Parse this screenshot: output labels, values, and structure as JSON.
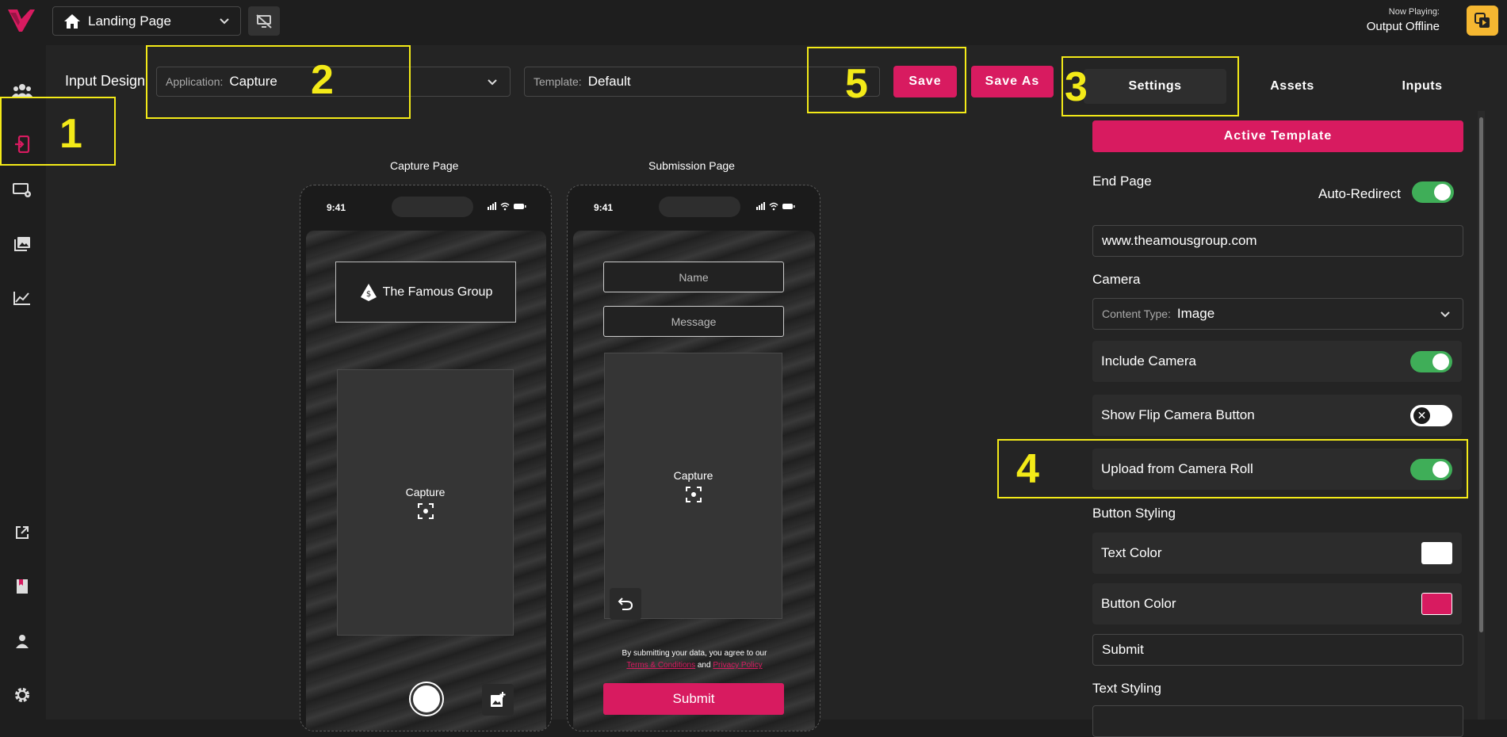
{
  "topbar": {
    "page_selector": "Landing Page",
    "now_playing_label": "Now Playing:",
    "now_playing_value": "Output Offline"
  },
  "toolbar": {
    "title": "Input Design",
    "application_label": "Application:",
    "application_value": "Capture",
    "template_label": "Template:",
    "template_value": "Default",
    "save_label": "Save",
    "save_as_label": "Save As"
  },
  "tabs": [
    {
      "label": "Settings",
      "active": true
    },
    {
      "label": "Assets",
      "active": false
    },
    {
      "label": "Inputs",
      "active": false
    }
  ],
  "annotations": [
    "1",
    "2",
    "3",
    "4",
    "5"
  ],
  "preview": {
    "capture_page": {
      "title": "Capture Page",
      "time": "9:41",
      "logo_text": "The Famous Group",
      "capture_label": "Capture"
    },
    "submission_page": {
      "title": "Submission Page",
      "time": "9:41",
      "name_placeholder": "Name",
      "message_placeholder": "Message",
      "capture_label": "Capture",
      "disclaimer_prefix": "By submitting your data, you agree to our",
      "terms_link": "Terms & Conditions",
      "and_text": "and",
      "privacy_link": "Privacy Policy",
      "submit_label": "Submit"
    }
  },
  "settings": {
    "active_template_label": "Active Template",
    "end_page_title": "End Page",
    "auto_redirect_label": "Auto-Redirect",
    "auto_redirect_on": true,
    "end_page_url": "www.theamousgroup.com",
    "camera_title": "Camera",
    "content_type_label": "Content Type:",
    "content_type_value": "Image",
    "include_camera_label": "Include Camera",
    "include_camera_on": true,
    "show_flip_label": "Show Flip Camera Button",
    "show_flip_on": false,
    "upload_roll_label": "Upload from Camera Roll",
    "upload_roll_on": true,
    "button_styling_title": "Button Styling",
    "text_color_label": "Text Color",
    "text_color_value": "#ffffff",
    "button_color_label": "Button Color",
    "button_color_value": "#d81b60",
    "button_text_value": "Submit",
    "text_styling_title": "Text Styling"
  },
  "colors": {
    "accent": "#d81b60",
    "annotation": "#f3ea18",
    "toggle_on": "#3fae58",
    "now_playing_badge": "#f5b731"
  }
}
